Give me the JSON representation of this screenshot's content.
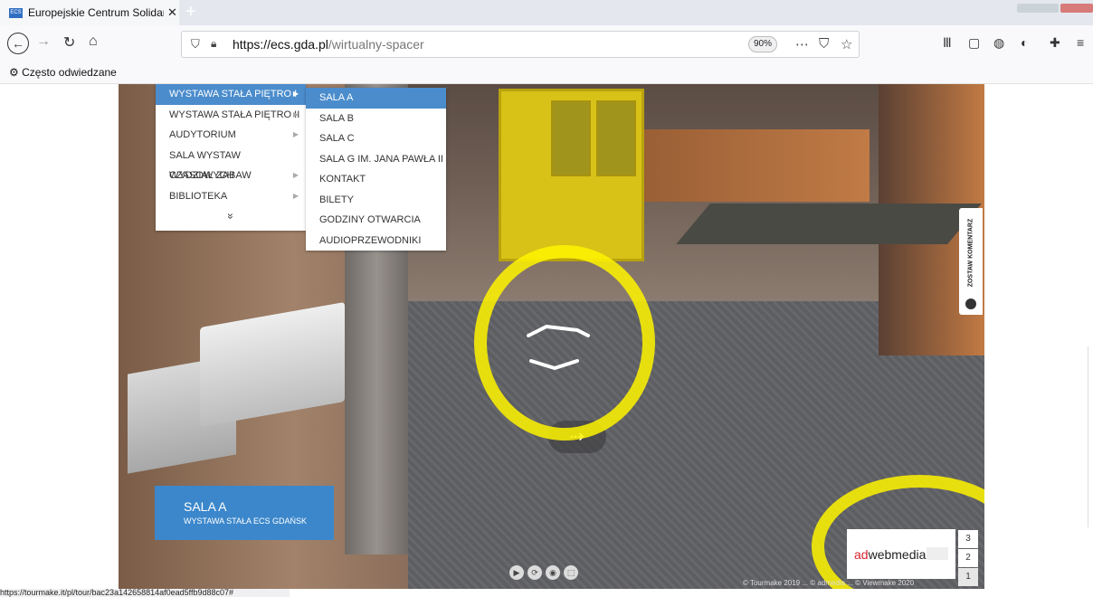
{
  "tab": {
    "title": "Europejskie Centrum Solidarno",
    "favicon": "ECS"
  },
  "nav": {
    "url_domain": "https://ecs.gda.pl",
    "url_path": "/wirtualny-spacer",
    "zoom": "90%"
  },
  "bookmarks": {
    "label": "Często odwiedzane"
  },
  "menu": {
    "items": [
      {
        "label": "WYSTAWA STAŁA PIĘTRO I",
        "arrow": "▶"
      },
      {
        "label": "WYSTAWA STAŁA PIĘTRO II",
        "arrow": "▶"
      },
      {
        "label": "AUDYTORIUM",
        "arrow": "▶"
      },
      {
        "label": "SALA WYSTAW CZASOWYCH",
        "arrow": ""
      },
      {
        "label": "WYDZIAŁ ZABAW",
        "arrow": "▶"
      },
      {
        "label": "BIBLIOTEKA",
        "arrow": "▶"
      }
    ],
    "more": "»"
  },
  "submenu": {
    "items": [
      {
        "label": "SALA A"
      },
      {
        "label": "SALA B"
      },
      {
        "label": "SALA C"
      },
      {
        "label": "SALA G IM. JANA PAWŁA II"
      },
      {
        "label": "KONTAKT"
      },
      {
        "label": "BILETY"
      },
      {
        "label": "GODZINY OTWARCIA"
      },
      {
        "label": "AUDIOPRZEWODNIKI"
      }
    ]
  },
  "location": {
    "title": "SALA A",
    "subtitle": "WYSTAWA STAŁA ECS GDAŃSK"
  },
  "comment": {
    "label": "ZOSTAW KOMENTARZ"
  },
  "logo": {
    "prefix": "ad",
    "brand": "webmedia"
  },
  "floors": [
    "3",
    "2",
    "1"
  ],
  "credits": "© Tourmake 2019 ... © admedia ... © Viewmake 2020",
  "status_url": "https://tourmake.it/pl/tour/bac23a142658814af0ead5ffb9d88c07#",
  "colors": {
    "accent": "#3c87cb",
    "highlight": "#fff500",
    "menu_active": "#4b8ccc"
  }
}
